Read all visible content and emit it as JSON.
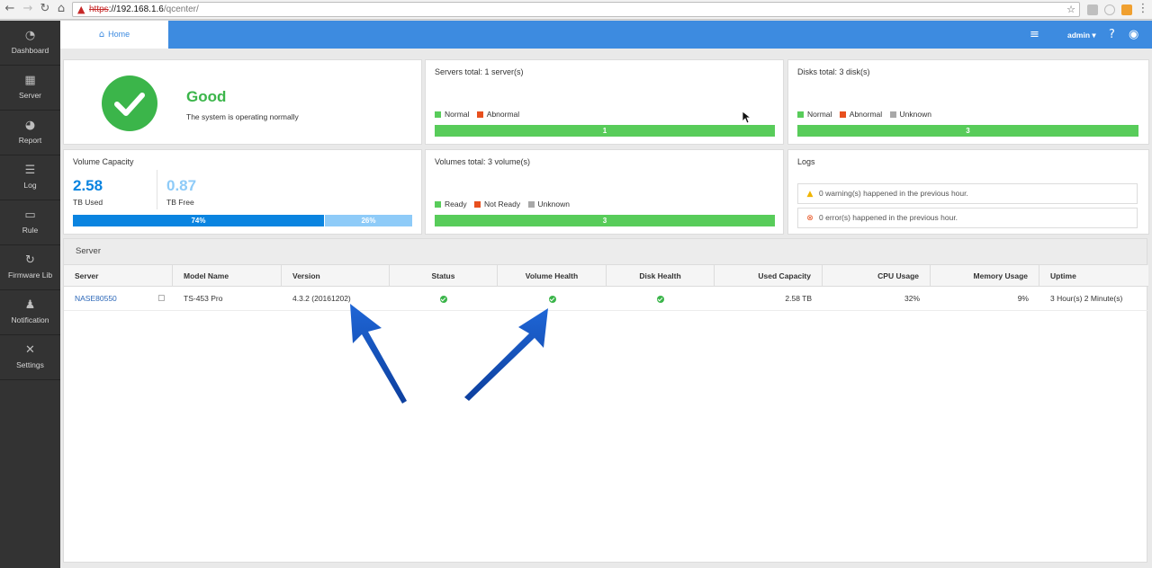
{
  "browser": {
    "url_scheme": "https",
    "url_host": "://192.168.1.6",
    "url_path": "/qcenter/"
  },
  "sidebar": {
    "items": [
      {
        "label": "Dashboard",
        "icon": "dashboard-icon"
      },
      {
        "label": "Server",
        "icon": "server-icon"
      },
      {
        "label": "Report",
        "icon": "pie-chart-icon"
      },
      {
        "label": "Log",
        "icon": "log-icon"
      },
      {
        "label": "Rule",
        "icon": "book-icon"
      },
      {
        "label": "Firmware Lib",
        "icon": "refresh-icon"
      },
      {
        "label": "Notification",
        "icon": "bell-icon"
      },
      {
        "label": "Settings",
        "icon": "tools-icon"
      }
    ]
  },
  "topbar": {
    "home_label": "Home",
    "user": "admin"
  },
  "status": {
    "title": "Good",
    "description": "The system is operating normally"
  },
  "servers": {
    "title": "Servers total: 1 server(s)",
    "legend": [
      "Normal",
      "Abnormal"
    ],
    "bar_value": "1",
    "colors": {
      "normal": "#58cc5a",
      "abnormal": "#e8501e"
    }
  },
  "disks": {
    "title": "Disks total: 3 disk(s)",
    "legend": [
      "Normal",
      "Abnormal",
      "Unknown"
    ],
    "bar_value": "3",
    "colors": {
      "normal": "#58cc5a",
      "abnormal": "#e8501e",
      "unknown": "#a8a8a8"
    }
  },
  "volume_capacity": {
    "title": "Volume Capacity",
    "used_value": "2.58",
    "used_label": "TB Used",
    "free_value": "0.87",
    "free_label": "TB Free",
    "used_percent_label": "74%",
    "free_percent_label": "26%",
    "used_fraction": 0.74
  },
  "volumes": {
    "title": "Volumes total: 3 volume(s)",
    "legend": [
      "Ready",
      "Not Ready",
      "Unknown"
    ],
    "bar_value": "3"
  },
  "logs": {
    "title": "Logs",
    "warning": "0 warning(s) happened in the previous hour.",
    "error": "0 error(s) happened in the previous hour."
  },
  "server_table": {
    "panel_title": "Server",
    "columns": [
      "Server",
      "Model Name",
      "Version",
      "Status",
      "Volume Health",
      "Disk Health",
      "Used Capacity",
      "CPU Usage",
      "Memory Usage",
      "Uptime"
    ],
    "rows": [
      {
        "server": "NASE80550",
        "model": "TS-453 Pro",
        "version": "4.3.2 (20161202)",
        "status": "ok",
        "volume_health": "ok",
        "disk_health": "ok",
        "used_capacity": "2.58 TB",
        "cpu": "32%",
        "memory": "9%",
        "uptime": "3 Hour(s) 2 Minute(s)"
      }
    ]
  }
}
